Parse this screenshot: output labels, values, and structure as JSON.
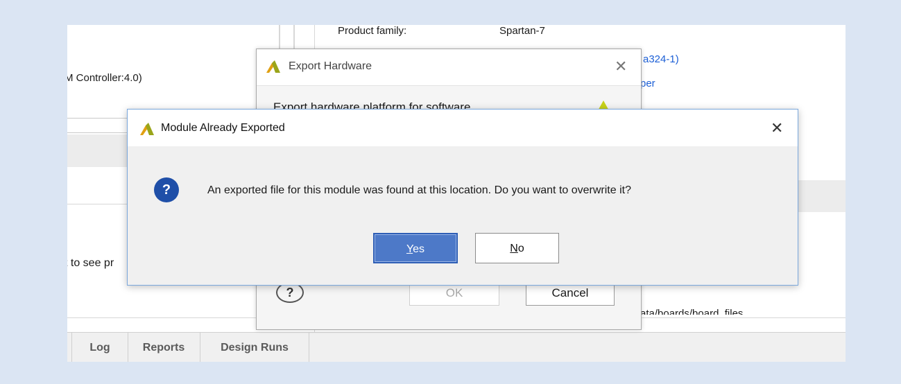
{
  "background": {
    "product_family_label": "Product family:",
    "product_family_value": "Spartan-7",
    "part_link": "a324-1)",
    "board_link": "per",
    "ip_text": "M Controller:4.0)",
    "hint_text": "t to see pr",
    "path_text": "ata/boards/board_files",
    "tabs": [
      "Log",
      "Reports",
      "Design Runs"
    ]
  },
  "export_hardware": {
    "title": "Export Hardware",
    "subtitle": "Export hardware platform for software",
    "ok_label": "OK",
    "cancel_label": "Cancel",
    "help_icon": "help-icon"
  },
  "module_dialog": {
    "title": "Module Already Exported",
    "message": "An exported file for this module was found at this location. Do you want to overwrite it?",
    "yes_mnemonic": "Y",
    "yes_rest": "es",
    "no_mnemonic": "N",
    "no_rest": "o",
    "icon": "question-icon"
  },
  "colors": {
    "accent": "#4d79c8",
    "link": "#1c5fd6",
    "question_icon": "#1f4fa8",
    "backdrop": "#dbe5f3"
  }
}
